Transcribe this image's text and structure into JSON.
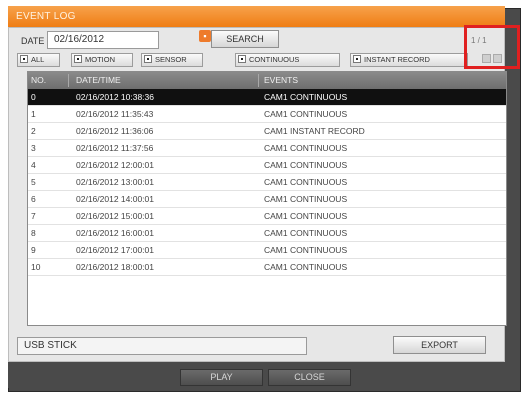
{
  "window": {
    "title": "EVENT LOG"
  },
  "filter": {
    "date_label": "DATE",
    "date_value": "02/16/2012",
    "search_label": "SEARCH",
    "page_indicator": "1 / 1",
    "checkboxes": {
      "all": "ALL",
      "motion": "MOTION",
      "sensor": "SENSOR",
      "continuous": "CONTINUOUS",
      "instant_record": "INSTANT RECORD"
    }
  },
  "table": {
    "columns": {
      "no": "NO.",
      "datetime": "DATE/TIME",
      "events": "EVENTS"
    },
    "rows": [
      {
        "no": "0",
        "datetime": "02/16/2012 10:38:36",
        "event": "CAM1 CONTINUOUS"
      },
      {
        "no": "1",
        "datetime": "02/16/2012 11:35:43",
        "event": "CAM1 CONTINUOUS"
      },
      {
        "no": "2",
        "datetime": "02/16/2012 11:36:06",
        "event": "CAM1 INSTANT RECORD"
      },
      {
        "no": "3",
        "datetime": "02/16/2012 11:37:56",
        "event": "CAM1 CONTINUOUS"
      },
      {
        "no": "4",
        "datetime": "02/16/2012 12:00:01",
        "event": "CAM1 CONTINUOUS"
      },
      {
        "no": "5",
        "datetime": "02/16/2012 13:00:01",
        "event": "CAM1 CONTINUOUS"
      },
      {
        "no": "6",
        "datetime": "02/16/2012 14:00:01",
        "event": "CAM1 CONTINUOUS"
      },
      {
        "no": "7",
        "datetime": "02/16/2012 15:00:01",
        "event": "CAM1 CONTINUOUS"
      },
      {
        "no": "8",
        "datetime": "02/16/2012 16:00:01",
        "event": "CAM1 CONTINUOUS"
      },
      {
        "no": "9",
        "datetime": "02/16/2012 17:00:01",
        "event": "CAM1 CONTINUOUS"
      },
      {
        "no": "10",
        "datetime": "02/16/2012 18:00:01",
        "event": "CAM1 CONTINUOUS"
      }
    ]
  },
  "export": {
    "device": "USB STICK",
    "export_label": "EXPORT"
  },
  "footer": {
    "play_label": "PLAY",
    "close_label": "CLOSE"
  },
  "icons": {
    "calendar": "calendar-icon",
    "page_prev": "page-prev-icon",
    "page_next": "page-next-icon"
  },
  "colors": {
    "title_orange": "#ef7d14",
    "highlight_red": "#e02020",
    "selected_row": "#101010"
  }
}
